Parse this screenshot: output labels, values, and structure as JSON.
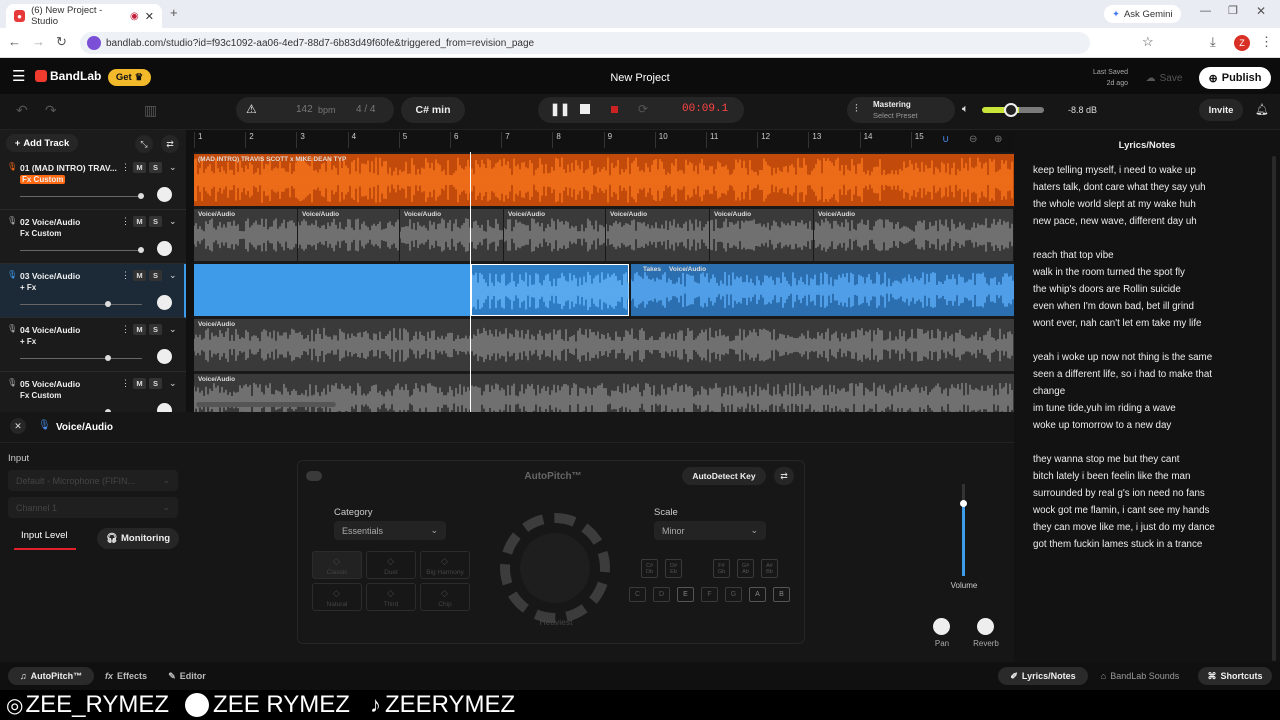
{
  "browser": {
    "tab_title": "(6) New Project - Studio",
    "url": "bandlab.com/studio?id=f93c1092-aa06-4ed7-88d7-6b83d49f60fe&triggered_from=revision_page",
    "ask_gemini": "Ask Gemini",
    "profile_initial": "Z"
  },
  "header": {
    "brand": "BandLab",
    "get_label": "Get",
    "project_title": "New Project",
    "last_saved_label": "Last Saved",
    "last_saved_value": "2d ago",
    "save_label": "Save",
    "publish_label": "Publish"
  },
  "toolbar": {
    "bpm_value": "142",
    "bpm_unit": "bpm",
    "time_sig": "4 / 4",
    "key": "C# min",
    "time": "00:09.1",
    "mastering_label": "Mastering",
    "mastering_preset": "Select Preset",
    "volume_db": "-8.8 dB",
    "volume_level": 0.33,
    "invite_label": "Invite"
  },
  "tracks_panel": {
    "add_track_label": "Add Track"
  },
  "tracks": [
    {
      "name": "01 (MAD INTRO) TRAV...",
      "fx": "Fx Custom",
      "color": "#ff6a13",
      "volume": 0.97,
      "clip_labels": [
        "(MAD INTRO) TRAVIS SCOTT x MIKE DEAN TYP"
      ]
    },
    {
      "name": "02 Voice/Audio",
      "fx": "Fx Custom",
      "color": "#8a8a8a",
      "volume": 0.97,
      "clip_labels": [
        "Voice/Audio",
        "Voice/Audio",
        "Voice/Audio",
        "Voice/Audio",
        "Voice/Audio",
        "Voice/Audio",
        "Voice/Audio"
      ]
    },
    {
      "name": "03 Voice/Audio",
      "fx": "+ Fx",
      "color": "#3d9bea",
      "volume": 0.69,
      "clip_labels": [
        "Takes",
        "Voice/Audio"
      ]
    },
    {
      "name": "04 Voice/Audio",
      "fx": "+ Fx",
      "color": "#8a8a8a",
      "volume": 0.69,
      "clip_labels": [
        "Voice/Audio"
      ]
    },
    {
      "name": "05 Voice/Audio",
      "fx": "Fx Custom",
      "color": "#8a8a8a",
      "volume": 0.69,
      "clip_labels": [
        "Voice/Audio"
      ]
    }
  ],
  "ruler": [
    "1",
    "2",
    "3",
    "4",
    "5",
    "6",
    "7",
    "8",
    "9",
    "10",
    "11",
    "12",
    "13",
    "14",
    "15"
  ],
  "editor": {
    "track_label": "Voice/Audio",
    "input_heading": "Input",
    "input_device": "Default - Microphone (FIFIN...",
    "channel": "Channel 1",
    "input_level_label": "Input Level",
    "monitoring_label": "Monitoring",
    "autopitch": {
      "title": "AutoPitch™",
      "autodetect_label": "AutoDetect Key",
      "category_label": "Category",
      "category_value": "Essentials",
      "scale_label": "Scale",
      "scale_value": "Minor",
      "knob_label": "Heaviest",
      "presets": [
        "Classic",
        "Duet",
        "Big Harmony",
        "Natural",
        "Third",
        "Chip"
      ],
      "sharp_keys": [
        "C#\nDb",
        "D#\nEb",
        "F#\nGb",
        "G#\nAb",
        "A#\nBb"
      ],
      "natural_keys": [
        "C",
        "D",
        "E",
        "F",
        "G",
        "A",
        "B"
      ]
    },
    "volume_label": "Volume",
    "volume_level": 0.88,
    "pan_label": "Pan",
    "reverb_label": "Reverb"
  },
  "lyrics": {
    "title": "Lyrics/Notes",
    "lines": [
      "keep telling myself, i need to wake up",
      "haters talk, dont care what they say yuh",
      "the whole world slept at my wake huh",
      "new pace, new wave, different day uh",
      "",
      "reach that top vibe",
      "walk in the room turned the spot fly",
      "the whip's doors are Rollin suicide",
      "even when I'm down bad, bet ill grind",
      "wont ever, nah can't let em take my life",
      "",
      "yeah i woke up now not thing is the same",
      "seen a different life, so i had to make that",
      "change",
      "im tune tide,yuh im riding a wave",
      "woke up tomorrow to a new day",
      "",
      "they wanna stop me but they cant",
      "bitch lately i been feelin like the man",
      "surrounded by real g's ion need no fans",
      "wock got me flamin, i cant see my hands",
      "they can move like me, i just do my dance",
      "got them fuckin lames stuck in a trance"
    ]
  },
  "footer": {
    "autopitch": "AutoPitch™",
    "effects": "Effects",
    "editor": "Editor",
    "lyrics": "Lyrics/Notes",
    "sounds": "BandLab Sounds",
    "shortcuts": "Shortcuts"
  },
  "overlay": {
    "instagram": "ZEE_RYMEZ",
    "spotify": "ZEE RYMEZ",
    "tiktok": "ZEERYMEZ"
  }
}
